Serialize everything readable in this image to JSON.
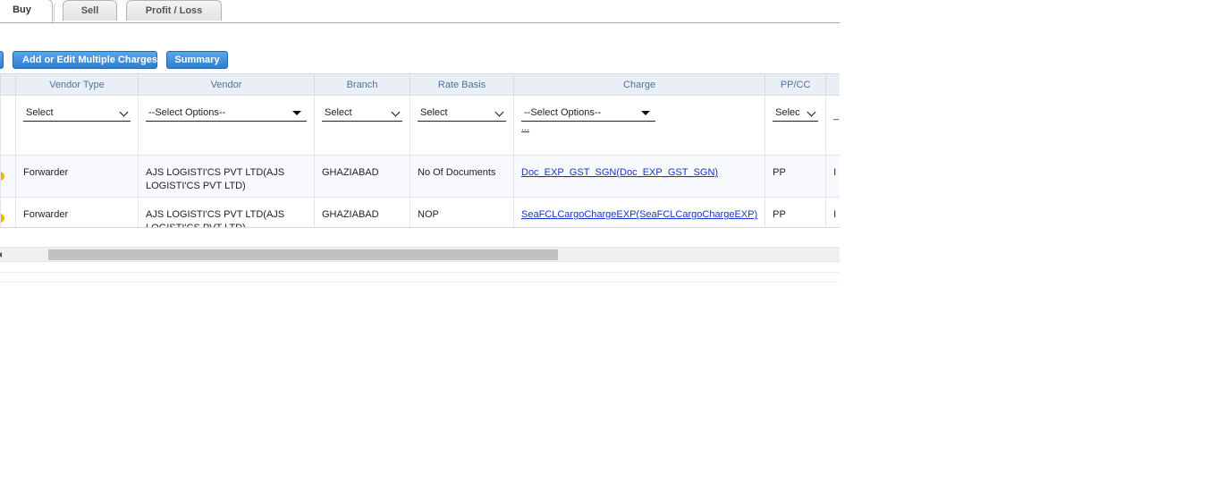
{
  "tabs": [
    {
      "label": "Buy",
      "active": true
    },
    {
      "label": "Sell",
      "active": false
    },
    {
      "label": "Profit / Loss",
      "active": false
    }
  ],
  "toolbar": {
    "add_edit_charges_label": "Add or Edit Multiple Charges",
    "summary_label": "Summary"
  },
  "grid": {
    "columns": [
      "Vendor Type",
      "Vendor",
      "Branch",
      "Rate Basis",
      "Charge",
      "PP/CC"
    ],
    "filters": {
      "vendor_type": "Select",
      "vendor": "--Select Options--",
      "branch": "Select",
      "rate_basis": "Select",
      "charge": "--Select Options--",
      "charge_more": "...",
      "ppcc": "Selec",
      "next": "_"
    },
    "rows": [
      {
        "vendor_type": "Forwarder",
        "vendor": "AJS LOGISTI'CS PVT LTD(AJS LOGISTI'CS PVT LTD)",
        "branch": "GHAZIABAD",
        "rate_basis": "No Of Documents",
        "charge": "Doc_EXP_GST_SGN(Doc_EXP_GST_SGN)",
        "ppcc": "PP",
        "next": "I"
      },
      {
        "vendor_type": "Forwarder",
        "vendor": "AJS LOGISTI'CS PVT LTD(AJS LOGISTI'CS PVT LTD)",
        "branch": "GHAZIABAD",
        "rate_basis": "NOP",
        "charge": "SeaFCLCargoChargeEXP(SeaFCLCargoChargeEXP)",
        "ppcc": "PP",
        "next": "I"
      }
    ]
  },
  "colors": {
    "accent_button": "#2d7fce",
    "header_text": "#4d74a0",
    "link": "#1a33c9",
    "status_dot": "#f1b400"
  }
}
